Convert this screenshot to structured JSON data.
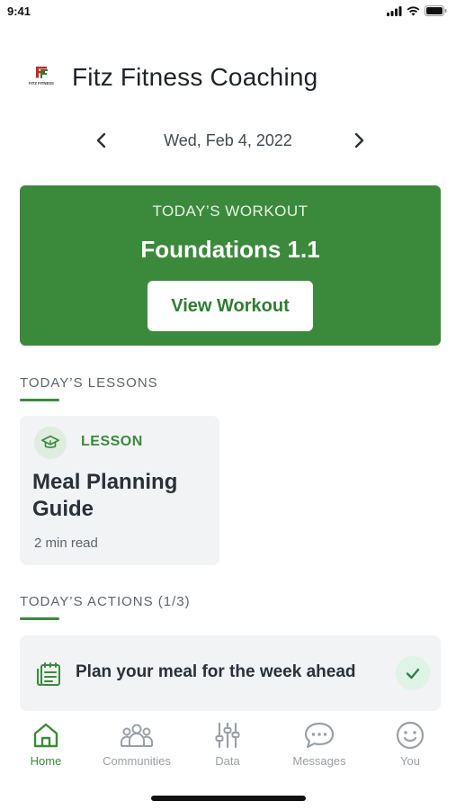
{
  "status_bar": {
    "time": "9:41"
  },
  "header": {
    "logo_text": "FITZ FITNESS",
    "title": "Fitz Fitness Coaching"
  },
  "date_nav": {
    "label": "Wed, Feb 4, 2022"
  },
  "workout": {
    "kicker": "TODAY’S WORKOUT",
    "title": "Foundations 1.1",
    "button_label": "View Workout"
  },
  "lessons": {
    "section_title": "TODAY’S LESSONS",
    "items": [
      {
        "kicker": "LESSON",
        "title": "Meal Planning Guide",
        "meta": "2 min read"
      }
    ]
  },
  "actions": {
    "section_title": "TODAY’S ACTIONS (1/3)",
    "items": [
      {
        "label": "Plan your meal for the week ahead",
        "completed": true
      }
    ]
  },
  "tabbar": {
    "tabs": [
      {
        "label": "Home",
        "icon": "home-icon",
        "active": true
      },
      {
        "label": "Communities",
        "icon": "people-icon",
        "active": false
      },
      {
        "label": "Data",
        "icon": "sliders-icon",
        "active": false
      },
      {
        "label": "Messages",
        "icon": "chat-icon",
        "active": false
      },
      {
        "label": "You",
        "icon": "smiley-icon",
        "active": false
      }
    ]
  },
  "colors": {
    "brand_green": "#3b8a3b",
    "inactive_gray": "#9aa0a6",
    "card_bg": "#f1f3f5"
  }
}
